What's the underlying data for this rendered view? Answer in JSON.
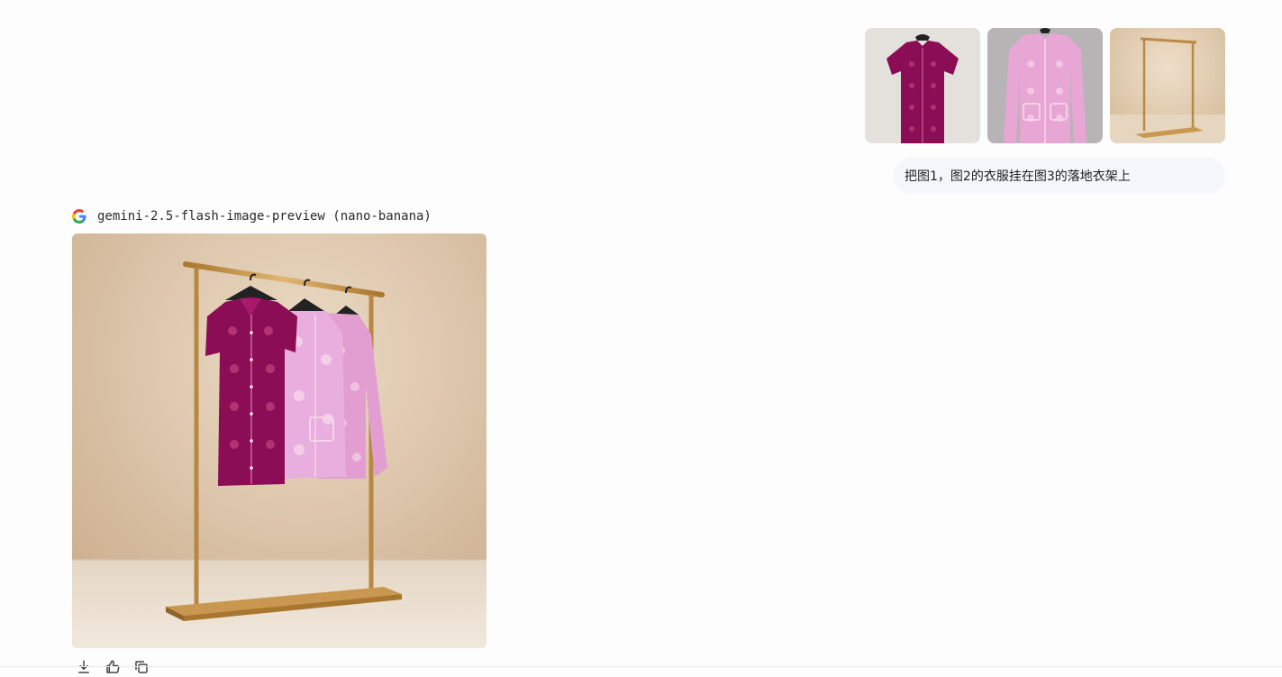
{
  "attachments": [
    {
      "name": "magenta-polo-dress",
      "icon": "image-thumbnail"
    },
    {
      "name": "pink-cardigan",
      "icon": "image-thumbnail"
    },
    {
      "name": "gold-clothing-rack",
      "icon": "image-thumbnail"
    }
  ],
  "user_message": {
    "text": "把图1，图2的衣服挂在图3的落地衣架上"
  },
  "model": {
    "name": "gemini-2.5-flash-image-preview (nano-banana)",
    "logo_icon": "google-g-icon"
  },
  "actions": [
    {
      "icon": "download-icon"
    },
    {
      "icon": "thumbs-up-icon"
    },
    {
      "icon": "copy-icon"
    }
  ],
  "colors": {
    "bubble_bg": "#f4f6fb",
    "page_bg": "#fdfdfe",
    "magenta_dress": "#8a0d55",
    "pink_cardigan": "#e7a6d4",
    "gold_rack": "#c9974f"
  }
}
